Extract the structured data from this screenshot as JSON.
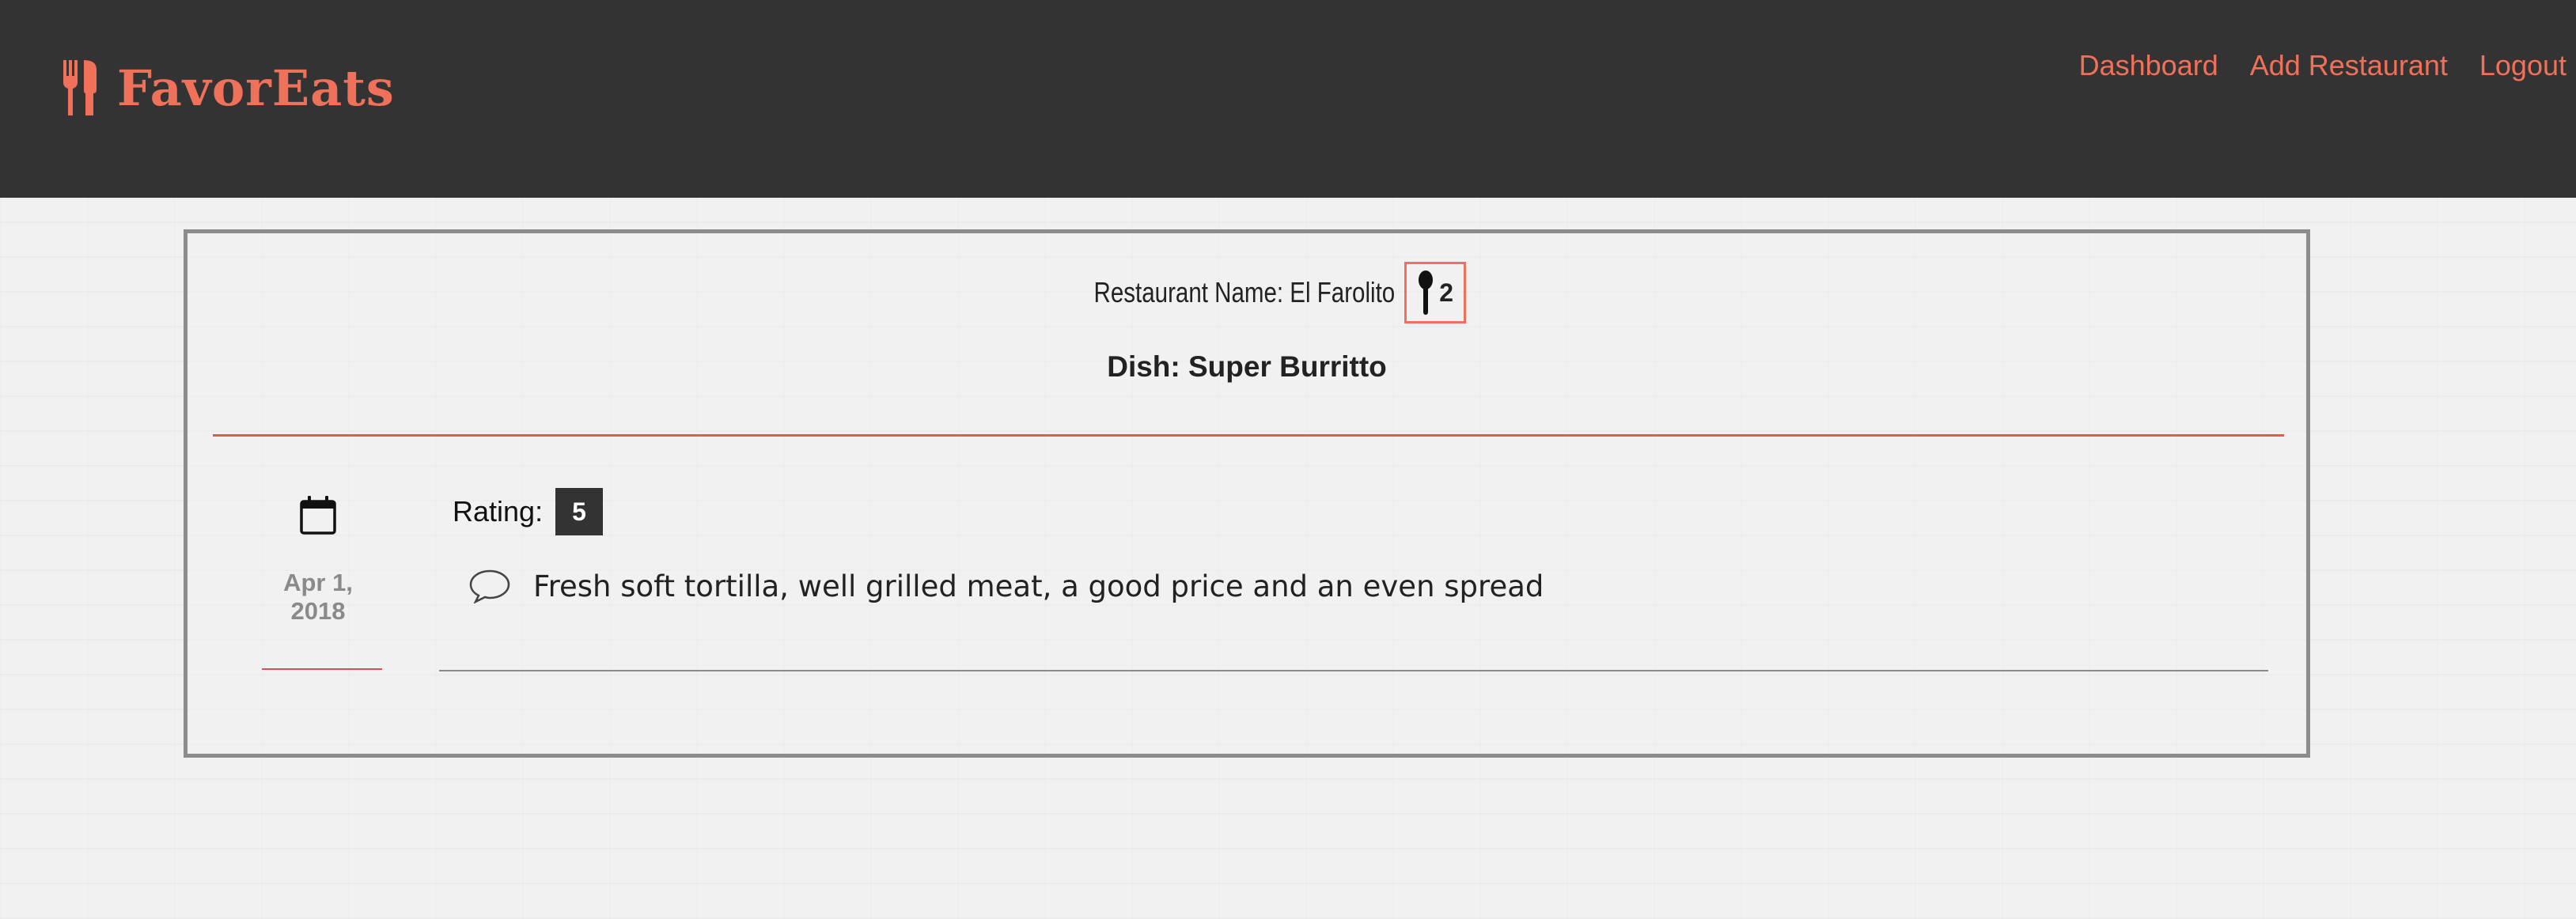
{
  "header": {
    "brand": "FavorEats",
    "nav": {
      "dashboard": "Dashboard",
      "add_restaurant": "Add Restaurant",
      "logout": "Logout"
    },
    "background_color": "#333333",
    "accent_color": "#f0715a"
  },
  "review": {
    "restaurant_label": "Restaurant Name: El Farolito",
    "spoon_count": "2",
    "dish": "Dish: Super Burritto",
    "date": "Apr 1,\n2018",
    "rating_label": "Rating:",
    "rating_value": "5",
    "comment": "Fresh soft tortilla, well grilled meat, a good price and an even spread"
  },
  "icons": {
    "brand": "fork-spoon-icon",
    "spoon": "spoon-icon",
    "calendar": "calendar-icon",
    "comment": "speech-bubble-icon"
  }
}
